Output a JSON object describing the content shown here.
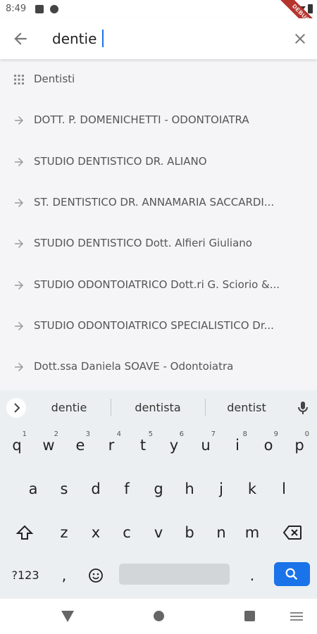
{
  "status_bar": {
    "time": "8:49",
    "debug_label": "DEBUG"
  },
  "search": {
    "value": "dentie",
    "placeholder": ""
  },
  "results": [
    {
      "icon": "category-grid-icon",
      "label": "Dentisti"
    },
    {
      "icon": "arrow-right-icon",
      "label": "DOTT. P. DOMENICHETTI - ODONTOIATRA"
    },
    {
      "icon": "arrow-right-icon",
      "label": "STUDIO DENTISTICO DR. ALIANO"
    },
    {
      "icon": "arrow-right-icon",
      "label": "ST. DENTISTICO DR.  ANNAMARIA SACCARDI..."
    },
    {
      "icon": "arrow-right-icon",
      "label": "STUDIO DENTISTICO Dott. Alfieri Giuliano"
    },
    {
      "icon": "arrow-right-icon",
      "label": "STUDIO ODONTOIATRICO Dott.ri G. Sciorio &..."
    },
    {
      "icon": "arrow-right-icon",
      "label": "STUDIO ODONTOIATRICO SPECIALISTICO Dr..."
    },
    {
      "icon": "arrow-right-icon",
      "label": "Dott.ssa Daniela SOAVE - Odontoiatra"
    }
  ],
  "keyboard": {
    "suggestions": [
      "dentie",
      "dentista",
      "dentist"
    ],
    "row1": [
      {
        "k": "q",
        "h": "1"
      },
      {
        "k": "w",
        "h": "2"
      },
      {
        "k": "e",
        "h": "3"
      },
      {
        "k": "r",
        "h": "4"
      },
      {
        "k": "t",
        "h": "5"
      },
      {
        "k": "y",
        "h": "6"
      },
      {
        "k": "u",
        "h": "7"
      },
      {
        "k": "i",
        "h": "8"
      },
      {
        "k": "o",
        "h": "9"
      },
      {
        "k": "p",
        "h": "0"
      }
    ],
    "row2": [
      "a",
      "s",
      "d",
      "f",
      "g",
      "h",
      "j",
      "k",
      "l"
    ],
    "row3": [
      "z",
      "x",
      "c",
      "v",
      "b",
      "n",
      "m"
    ],
    "symbols_label": "?123",
    "comma": ",",
    "period": "."
  },
  "colors": {
    "accent": "#1a73e8",
    "list_background": "#f5f5f7",
    "keyboard_background": "#eceff1",
    "debug_ribbon": "#b5342e"
  }
}
